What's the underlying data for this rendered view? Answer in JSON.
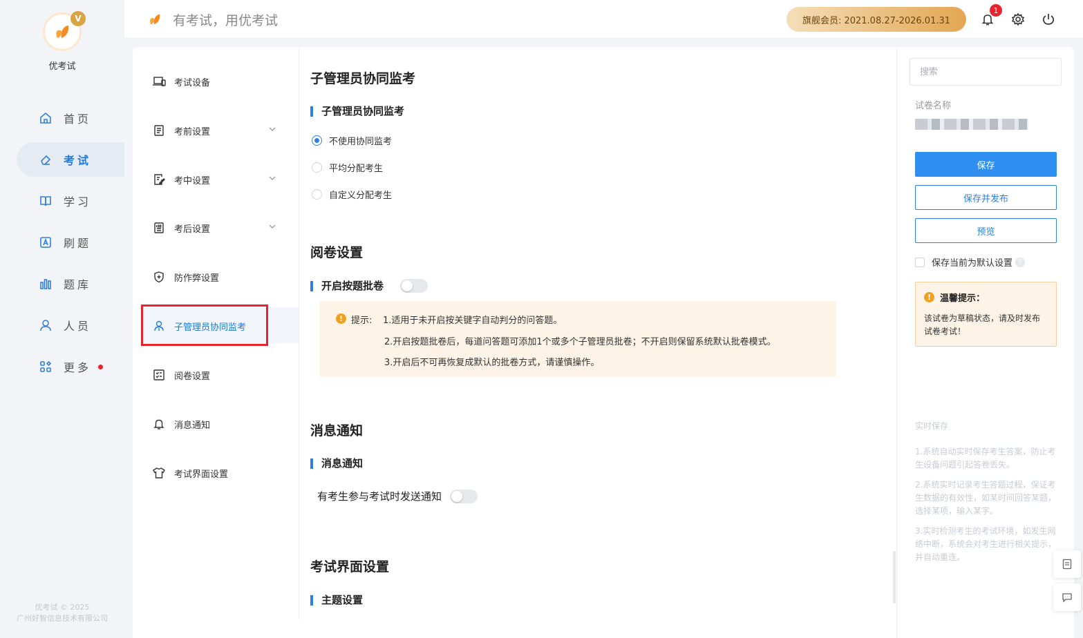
{
  "app": {
    "name": "优考试",
    "slogan": "有考试，用优考试"
  },
  "nav": {
    "items": [
      {
        "label": "首页",
        "icon": "home-icon"
      },
      {
        "label": "考试",
        "icon": "eraser-icon",
        "active": true
      },
      {
        "label": "学习",
        "icon": "book-icon"
      },
      {
        "label": "刷题",
        "icon": "letter-a-icon"
      },
      {
        "label": "题库",
        "icon": "bars-icon"
      },
      {
        "label": "人员",
        "icon": "user-icon"
      },
      {
        "label": "更多",
        "icon": "grid-icon",
        "dot": true
      }
    ],
    "copyright_line1": "优考试 © 2025",
    "copyright_line2": "广州好智信息技术有限公司"
  },
  "header": {
    "member_text": "旗舰会员:  2021.08.27-2026.01.31",
    "notification_count": "1"
  },
  "menu": {
    "items": [
      {
        "label": "考试设备",
        "icon": "laptop-icon"
      },
      {
        "label": "考前设置",
        "icon": "document-icon",
        "expandable": true
      },
      {
        "label": "考中设置",
        "icon": "edit-doc-icon",
        "expandable": true
      },
      {
        "label": "考后设置",
        "icon": "score-doc-icon",
        "expandable": true
      },
      {
        "label": "防作弊设置",
        "icon": "shield-icon"
      },
      {
        "label": "子管理员协同监考",
        "icon": "user-icon",
        "active": true
      },
      {
        "label": "阅卷设置",
        "icon": "checklist-icon"
      },
      {
        "label": "消息通知",
        "icon": "bell-icon"
      },
      {
        "label": "考试界面设置",
        "icon": "shirt-icon"
      }
    ]
  },
  "content": {
    "proctor": {
      "title": "子管理员协同监考",
      "subtitle": "子管理员协同监考",
      "options": [
        "不使用协同监考",
        "平均分配考生",
        "自定义分配考生"
      ],
      "selected": 0
    },
    "grading": {
      "title": "阅卷设置",
      "subtitle": "开启按题批卷",
      "tip_label": "提示:",
      "tips": [
        "1.适用于未开启按关键字自动判分的问答题。",
        "2.开启按题批卷后，每道问答题可添加1个或多个子管理员批卷；不开启则保留系统默认批卷模式。",
        "3.开启后不可再恢复成默认的批卷方式，请谨慎操作。"
      ]
    },
    "notify": {
      "title": "消息通知",
      "subtitle": "消息通知",
      "option_label": "有考生参与考试时发送通知"
    },
    "ui_settings": {
      "title": "考试界面设置",
      "subtitle": "主题设置"
    }
  },
  "right": {
    "search_placeholder": "搜索",
    "paper_label": "试卷名称",
    "save_label": "保存",
    "save_publish_label": "保存并发布",
    "preview_label": "预览",
    "default_label": "保存当前为默认设置",
    "notice_title": "温馨提示：",
    "notice_body": "该试卷为草稿状态，请及时发布试卷考试！",
    "realtime_title": "实时保存",
    "realtime_items": [
      "1.系统自动实时保存考生答案，防止考生设备问题引起答卷丢失。",
      "2.系统实时记录考生答题过程，保证考生数据的有效性，如某时间回答某题，选择某项，输入某字。",
      "3.实时检测考生的考试环境，如发生网络中断，系统会对考生进行相关提示，并自动重连。"
    ]
  },
  "colors": {
    "accent": "#2f7fe0",
    "primary_button": "#2f8ff0",
    "warning": "#f0a020",
    "highlight": "#e5242b"
  }
}
